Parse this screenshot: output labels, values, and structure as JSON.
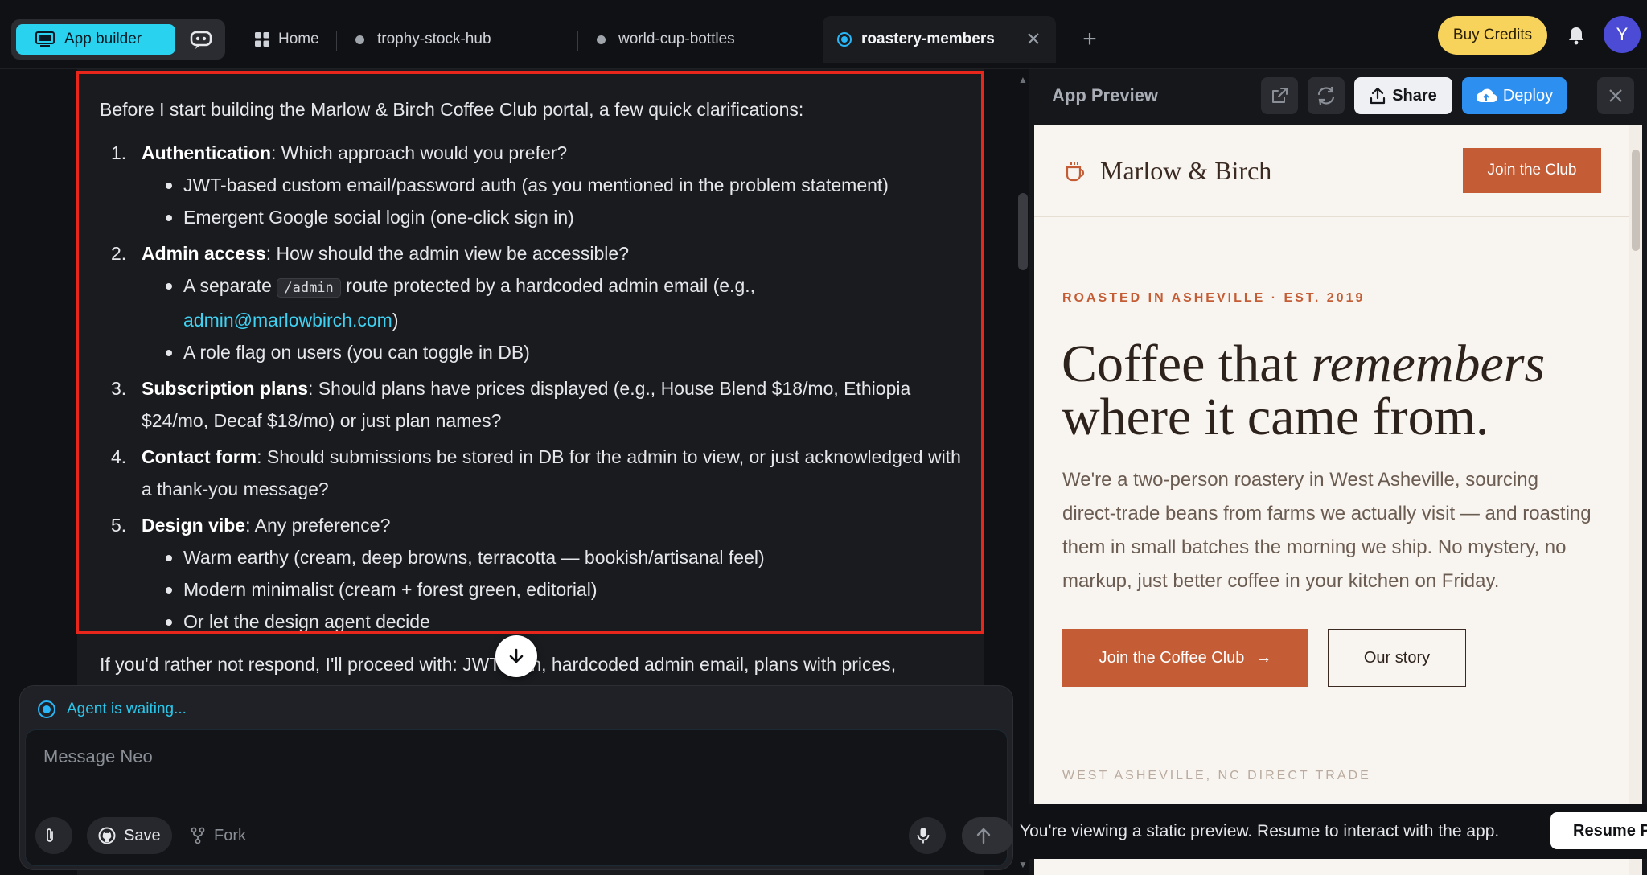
{
  "topbar": {
    "mode_active": "App builder",
    "home_tab": "Home",
    "tabs": [
      {
        "label": "trophy-stock-hub"
      },
      {
        "label": "world-cup-bottles"
      }
    ],
    "active_tab": "roastery-members",
    "buy_credits": "Buy Credits",
    "avatar_initial": "Y"
  },
  "chat": {
    "intro": "Before I start building the Marlow & Birch Coffee Club portal, a few quick clarifications:",
    "questions": [
      {
        "num": "1.",
        "title": "Authentication",
        "text": ": Which approach would you prefer?",
        "options": [
          "JWT-based custom email/password auth (as you mentioned in the problem statement)",
          "Emergent Google social login (one-click sign in)"
        ]
      },
      {
        "num": "2.",
        "title": "Admin access",
        "text": ": How should the admin view be accessible?",
        "option1_before": "A separate ",
        "option1_code": "/admin",
        "option1_after": " route protected by a hardcoded admin email (e.g.,",
        "option1_link": "admin@marlowbirch.com",
        "option1_close": ")",
        "option2": "A role flag on users (you can toggle in DB)"
      },
      {
        "num": "3.",
        "title": "Subscription plans",
        "text": ": Should plans have prices displayed (e.g., House Blend $18/mo, Ethiopia $24/mo, Decaf $18/mo) or just plan names?"
      },
      {
        "num": "4.",
        "title": "Contact form",
        "text": ": Should submissions be stored in DB for the admin to view, or just acknowledged with a thank-you message?"
      },
      {
        "num": "5.",
        "title": "Design vibe",
        "text": ": Any preference?",
        "options": [
          "Warm earthy (cream, deep browns, terracotta — bookish/artisanal feel)",
          "Modern minimalist (cream + forest green, editorial)",
          "Or let the design agent decide"
        ]
      }
    ],
    "fallback": "If you'd rather not respond, I'll proceed with: JWT auth, hardcoded admin email, plans with prices,",
    "agent_status": "Agent is waiting...",
    "composer_placeholder": "Message Neo",
    "save_label": "Save",
    "fork_label": "Fork"
  },
  "preview": {
    "title": "App Preview",
    "share": "Share",
    "deploy": "Deploy",
    "site": {
      "brand": "Marlow & Birch",
      "join_top": "Join the Club",
      "eyebrow": "ROASTED IN ASHEVILLE · EST. 2019",
      "hero_line1_plain": "Coffee that ",
      "hero_line1_italic": "remembers",
      "hero_line2": "where it came from.",
      "body": "We're a two-person roastery in West Asheville, sourcing direct-trade beans from farms we actually visit — and roasting them in small batches the morning we ship. No mystery, no markup, just better coffee in your kitchen on Friday.",
      "cta_primary": "Join the Coffee Club",
      "cta_secondary": "Our story",
      "peek": "WEST ASHEVILLE, NC    DIRECT TRADE"
    },
    "static_banner": "You're viewing a static preview. Resume to interact with the app.",
    "resume": "Resume Preview"
  },
  "colors": {
    "accent_cyan": "#29d3f0",
    "terracotta": "#c45d35",
    "credits_yellow": "#f7d35c",
    "deploy_blue": "#2d8ff0",
    "highlight_red": "#e8261c"
  }
}
